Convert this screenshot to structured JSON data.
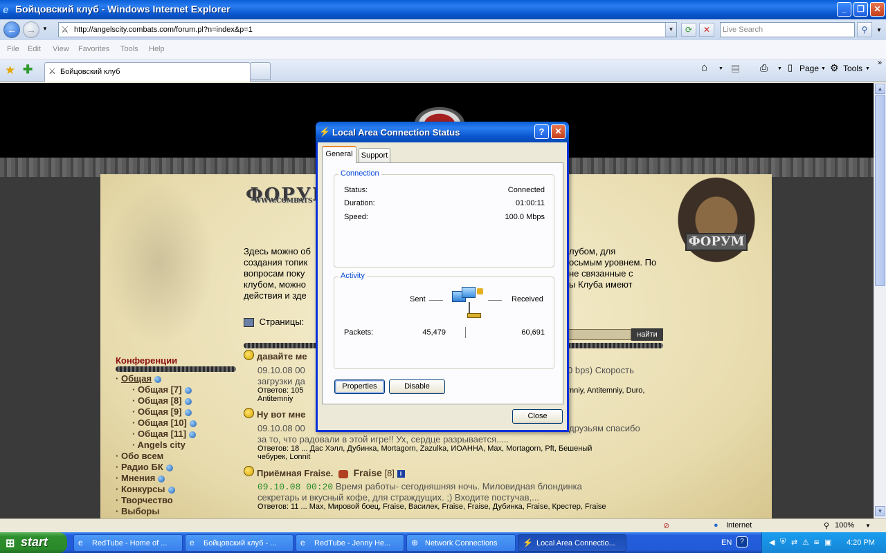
{
  "browser": {
    "window_title": "Бойцовский клуб - Windows Internet Explorer",
    "url": "http://angelscity.combats.com/forum.pl?n=index&p=1",
    "search_placeholder": "Live Search",
    "menu": [
      "File",
      "Edit",
      "View",
      "Favorites",
      "Tools",
      "Help"
    ],
    "tab_title": "Бойцовский клуб",
    "command_bar": {
      "page": "Page",
      "tools": "Tools"
    }
  },
  "page": {
    "forum_heading": "ФОРУМ",
    "forum_sub": "WWW.COMBATS",
    "shield_label": "ФОРУМ",
    "intro_lines": [
      "Здесь можно об",
      "создания топик",
      "вопросам поку",
      "клубом, можно",
      "действия и зде"
    ],
    "intro_right_lines": [
      "лубом, для",
      "осьмым уровнем. По",
      "не связанные с",
      "ы Клуба имеют",
      ""
    ],
    "pages_label": "Страницы:",
    "find_button": "найти",
    "conferences_title": "Конференции",
    "conferences": [
      {
        "label": "Общая",
        "level": 0,
        "link": true,
        "globe": true
      },
      {
        "label": "Общая [7]",
        "level": 1,
        "globe": true
      },
      {
        "label": "Общая [8]",
        "level": 1,
        "globe": true
      },
      {
        "label": "Общая [9]",
        "level": 1,
        "globe": true
      },
      {
        "label": "Общая [10]",
        "level": 1,
        "globe": true
      },
      {
        "label": "Общая [11]",
        "level": 1,
        "globe": true
      },
      {
        "label": "Angels city",
        "level": 1,
        "globe": false
      },
      {
        "label": "Обо всем",
        "level": 0,
        "globe": false
      },
      {
        "label": "Радио БК",
        "level": 0,
        "globe": true
      },
      {
        "label": "Мнения",
        "level": 0,
        "globe": true
      },
      {
        "label": "Конкурсы",
        "level": 0,
        "globe": true
      },
      {
        "label": "Творчество",
        "level": 0,
        "globe": false
      },
      {
        "label": "Выборы",
        "level": 0,
        "globe": false
      }
    ],
    "topics": [
      {
        "title": "давайте ме",
        "timestamp": "09.10.08 00",
        "body_right": "0 bps) Скорость",
        "body_line2": "загрузки да",
        "replies": "Ответов: 105",
        "replies_right": "mniy, Antitemniy, Duro,",
        "replies_line2": "Antitemniy"
      },
      {
        "title": "Ну вот мне",
        "timestamp": "09.10.08 00",
        "body_right": "друзьям спасибо",
        "body_line2": "за то, что радовали в этой игре!! Ух, сердце разрывается.....",
        "replies": "Ответов: 18   ... Дас Хэлл, Дубинка, Mortagorn, Zazulka, ИОАННА, Max, Mortagorn, Pft, Бешеный",
        "replies_line2": "чебурек, Lonnit"
      },
      {
        "title": "Приёмная Fraise.",
        "author": "Fraise",
        "level": "[8]",
        "timestamp": "09.10.08 00:20",
        "body_line1": "Время работы- сегодняшняя ночь. Миловидная блондинка",
        "body_line2": "секретарь и вкусный кофе, для страждущих. ;) Входите постучав,...",
        "replies": "Ответов: 11   ... Max, Мировой боец, Fraise, Василек, Fraise, Fraise, Дубинка, Fraise, Крестер, Fraise"
      }
    ]
  },
  "statusbar": {
    "zone": "Internet",
    "zoom": "100%"
  },
  "dialog": {
    "title": "Local Area Connection Status",
    "tabs": [
      "General",
      "Support"
    ],
    "connection_legend": "Connection",
    "status_label": "Status:",
    "status_value": "Connected",
    "duration_label": "Duration:",
    "duration_value": "01:00:11",
    "speed_label": "Speed:",
    "speed_value": "100.0 Mbps",
    "activity_legend": "Activity",
    "sent_label": "Sent",
    "received_label": "Received",
    "packets_label": "Packets:",
    "packets_sent": "45,479",
    "packets_received": "60,691",
    "properties_button": "Properties",
    "disable_button": "Disable",
    "close_button": "Close"
  },
  "taskbar": {
    "start_label": "start",
    "items": [
      {
        "label": "RedTube - Home of ...",
        "active": false
      },
      {
        "label": "Бойцовский клуб - ...",
        "active": false
      },
      {
        "label": "RedTube - Jenny He...",
        "active": false
      },
      {
        "label": "Network Connections",
        "active": false
      },
      {
        "label": "Local Area Connectio...",
        "active": true
      }
    ],
    "language": "EN",
    "clock": "4:20 PM"
  }
}
